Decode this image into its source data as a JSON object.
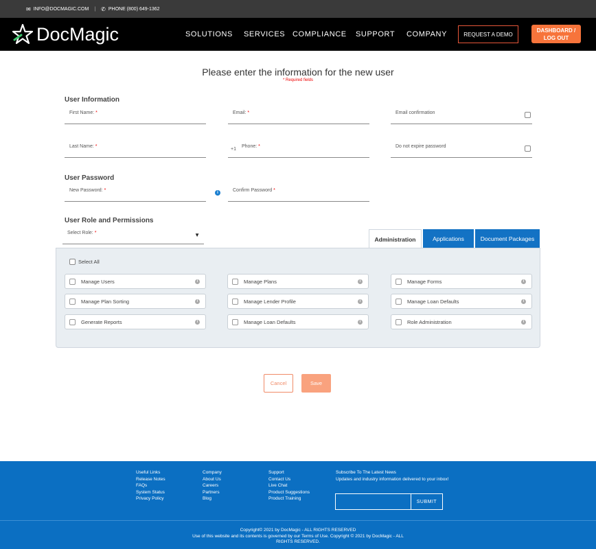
{
  "topbar": {
    "email": "INFO@DOCMAGIC.COM",
    "phone": "PHONE (800) 649-1362"
  },
  "nav": {
    "logo": "DocMagic",
    "menu": [
      "SOLUTIONS",
      "SERVICES",
      "COMPLIANCE",
      "SUPPORT",
      "COMPANY"
    ],
    "request_demo": "REQUEST A DEMO",
    "dashboard_line1": "DASHBOARD /",
    "dashboard_line2": "LOG OUT",
    "accent": "#f7743b"
  },
  "form": {
    "title": "Please enter the information for the new user",
    "required_note": "* Required fields",
    "sections": {
      "user_info": "User Information",
      "user_password": "User Password",
      "role_permissions": "User Role and Permissions"
    },
    "fields": {
      "first_name": "First Name:",
      "email": "Email:",
      "email_confirmation": "Email confirmation",
      "last_name": "Last Name:",
      "phone_prefix": "+1",
      "phone": "Phone:",
      "do_not_expire": "Do not expire password",
      "new_password": "New Password:",
      "confirm_password": "Confirm Password",
      "select_role": "Select Role:",
      "required_star": "*"
    }
  },
  "tabs": [
    "Administration",
    "Applications",
    "Document Packages"
  ],
  "permissions": {
    "select_all": "Select All",
    "items": [
      "Manage Users",
      "Manage Plans",
      "Manage Forms",
      "Manage Plan Sorting",
      "Manage Lender Profile",
      "Manage Loan Defaults",
      "Generate Reports",
      "Manage Loan Defaults",
      "Role Administration"
    ]
  },
  "actions": {
    "cancel": "Cancel",
    "save": "Save"
  },
  "footer": {
    "col1": [
      "Useful Links",
      "Release Notes",
      "FAQs",
      "System Status",
      "Privacy Policy"
    ],
    "col2": [
      "Company",
      "About Us",
      "Careers",
      "Partners",
      "Blog"
    ],
    "col3": [
      "Support",
      "Contact Us",
      "Live Chat",
      "Product Suggestions",
      "Product Training"
    ],
    "subscribe_title": "Subscribe To The Latest News",
    "subscribe_text": "Updates and industry information delivered to your inbox!",
    "submit": "SUBMIT",
    "copyright_line1": "Copyright© 2021 by DocMagic - ALL RIGHTS RESERVED",
    "copyright_line2": "Use of this website and its contents is governed by our Terms of Use. Copyright © 2021 by DocMagic - ALL",
    "copyright_line3": "RIGHTS RESERVED."
  }
}
